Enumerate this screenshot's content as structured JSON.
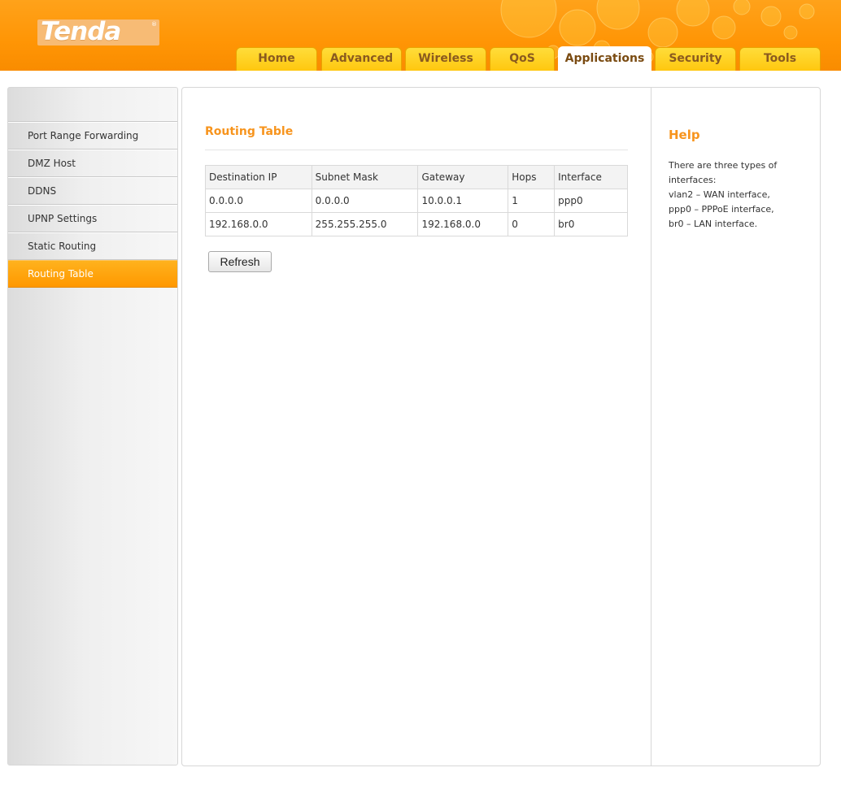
{
  "brand": {
    "name": "Tenda",
    "mark": "®"
  },
  "tabs": [
    {
      "label": "Home",
      "active": false
    },
    {
      "label": "Advanced",
      "active": false
    },
    {
      "label": "Wireless",
      "active": false
    },
    {
      "label": "QoS",
      "active": false
    },
    {
      "label": "Applications",
      "active": true
    },
    {
      "label": "Security",
      "active": false
    },
    {
      "label": "Tools",
      "active": false
    }
  ],
  "sidebar": {
    "items": [
      {
        "label": "Port Range Forwarding",
        "active": false
      },
      {
        "label": "DMZ Host",
        "active": false
      },
      {
        "label": "DDNS",
        "active": false
      },
      {
        "label": "UPNP Settings",
        "active": false
      },
      {
        "label": "Static Routing",
        "active": false
      },
      {
        "label": "Routing Table",
        "active": true
      }
    ]
  },
  "main": {
    "title": "Routing Table",
    "table": {
      "headers": [
        "Destination IP",
        "Subnet Mask",
        "Gateway",
        "Hops",
        "Interface"
      ],
      "rows": [
        [
          "0.0.0.0",
          "0.0.0.0",
          "10.0.0.1",
          "1",
          "ppp0"
        ],
        [
          "192.168.0.0",
          "255.255.255.0",
          "192.168.0.0",
          "0",
          "br0"
        ]
      ]
    },
    "refresh_label": "Refresh"
  },
  "help": {
    "title": "Help",
    "lines": [
      "There are three types of",
      "interfaces:",
      "vlan2 – WAN interface,",
      "ppp0 – PPPoE interface,",
      "br0 – LAN interface."
    ]
  },
  "colors": {
    "accent": "#f7941d",
    "header": "#ff9505",
    "tab": "#ffc70f",
    "active_menu": "#ff9800"
  }
}
